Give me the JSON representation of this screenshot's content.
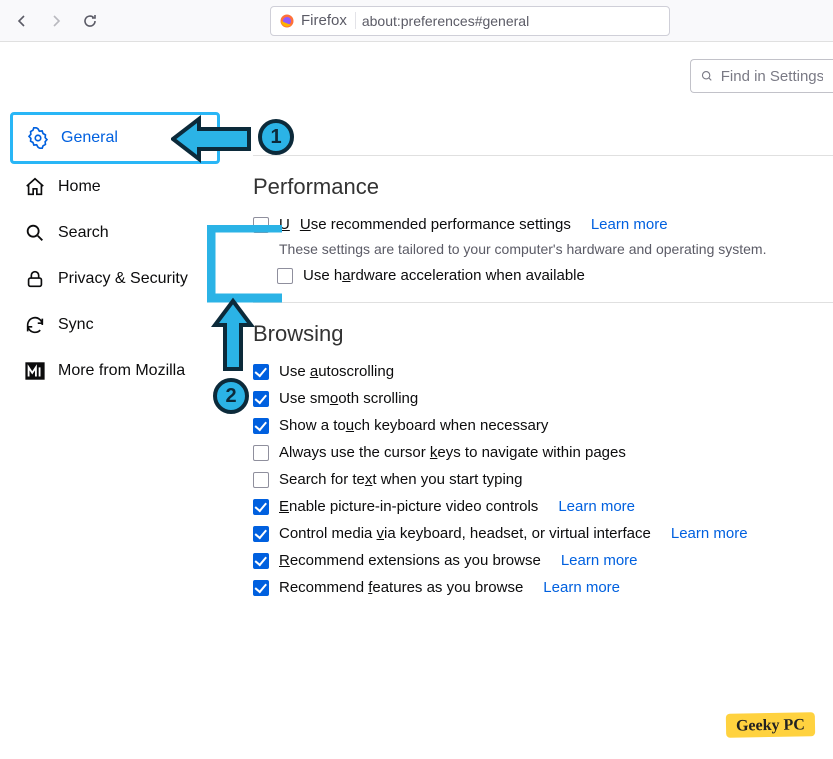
{
  "toolbar": {
    "identity_label": "Firefox",
    "url": "about:preferences#general"
  },
  "search_settings": {
    "placeholder": "Find in Settings"
  },
  "sidebar": {
    "items": [
      {
        "label": "General"
      },
      {
        "label": "Home"
      },
      {
        "label": "Search"
      },
      {
        "label": "Privacy & Security"
      },
      {
        "label": "Sync"
      },
      {
        "label": "More from Mozilla"
      }
    ]
  },
  "performance": {
    "heading": "Performance",
    "recommended_label": "Use recommended performance settings",
    "recommended_learn": "Learn more",
    "recommended_desc": "These settings are tailored to your computer's hardware and operating system.",
    "hwaccel_label": "Use hardware acceleration when available"
  },
  "browsing": {
    "heading": "Browsing",
    "autoscroll": "Use autoscrolling",
    "smooth": "Use smooth scrolling",
    "touchkb": "Show a touch keyboard when necessary",
    "cursorkeys": "Always use the cursor keys to navigate within pages",
    "searchtype": "Search for text when you start typing",
    "pip": "Enable picture-in-picture video controls",
    "pip_learn": "Learn more",
    "media": "Control media via keyboard, headset, or virtual interface",
    "media_learn": "Learn more",
    "recext": "Recommend extensions as you browse",
    "recext_learn": "Learn more",
    "recfeat": "Recommend features as you browse",
    "recfeat_learn": "Learn more"
  },
  "annotations": {
    "step1": "1",
    "step2": "2"
  },
  "watermark": "Geeky PC"
}
